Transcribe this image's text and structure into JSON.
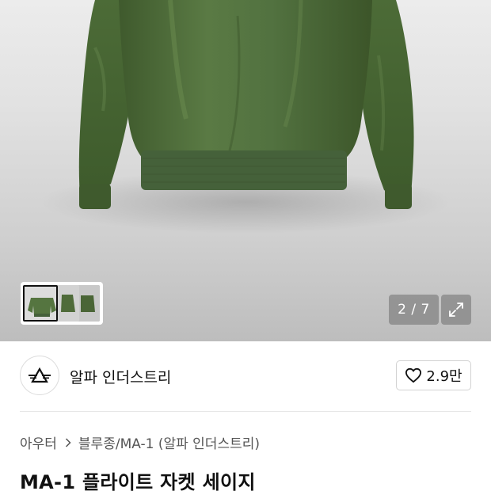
{
  "gallery": {
    "counter": "2 / 7",
    "thumbnails": [
      "front-view",
      "side-view",
      "back-view"
    ],
    "jacket_color": "#4f6b3a"
  },
  "brand": {
    "name": "알파 인더스트리",
    "like_count": "2.9만"
  },
  "breadcrumb": {
    "items": [
      "아우터",
      "블루종/MA-1 (알파 인더스트리)"
    ]
  },
  "product": {
    "title": "MA-1 플라이트 자켓 세이지"
  }
}
